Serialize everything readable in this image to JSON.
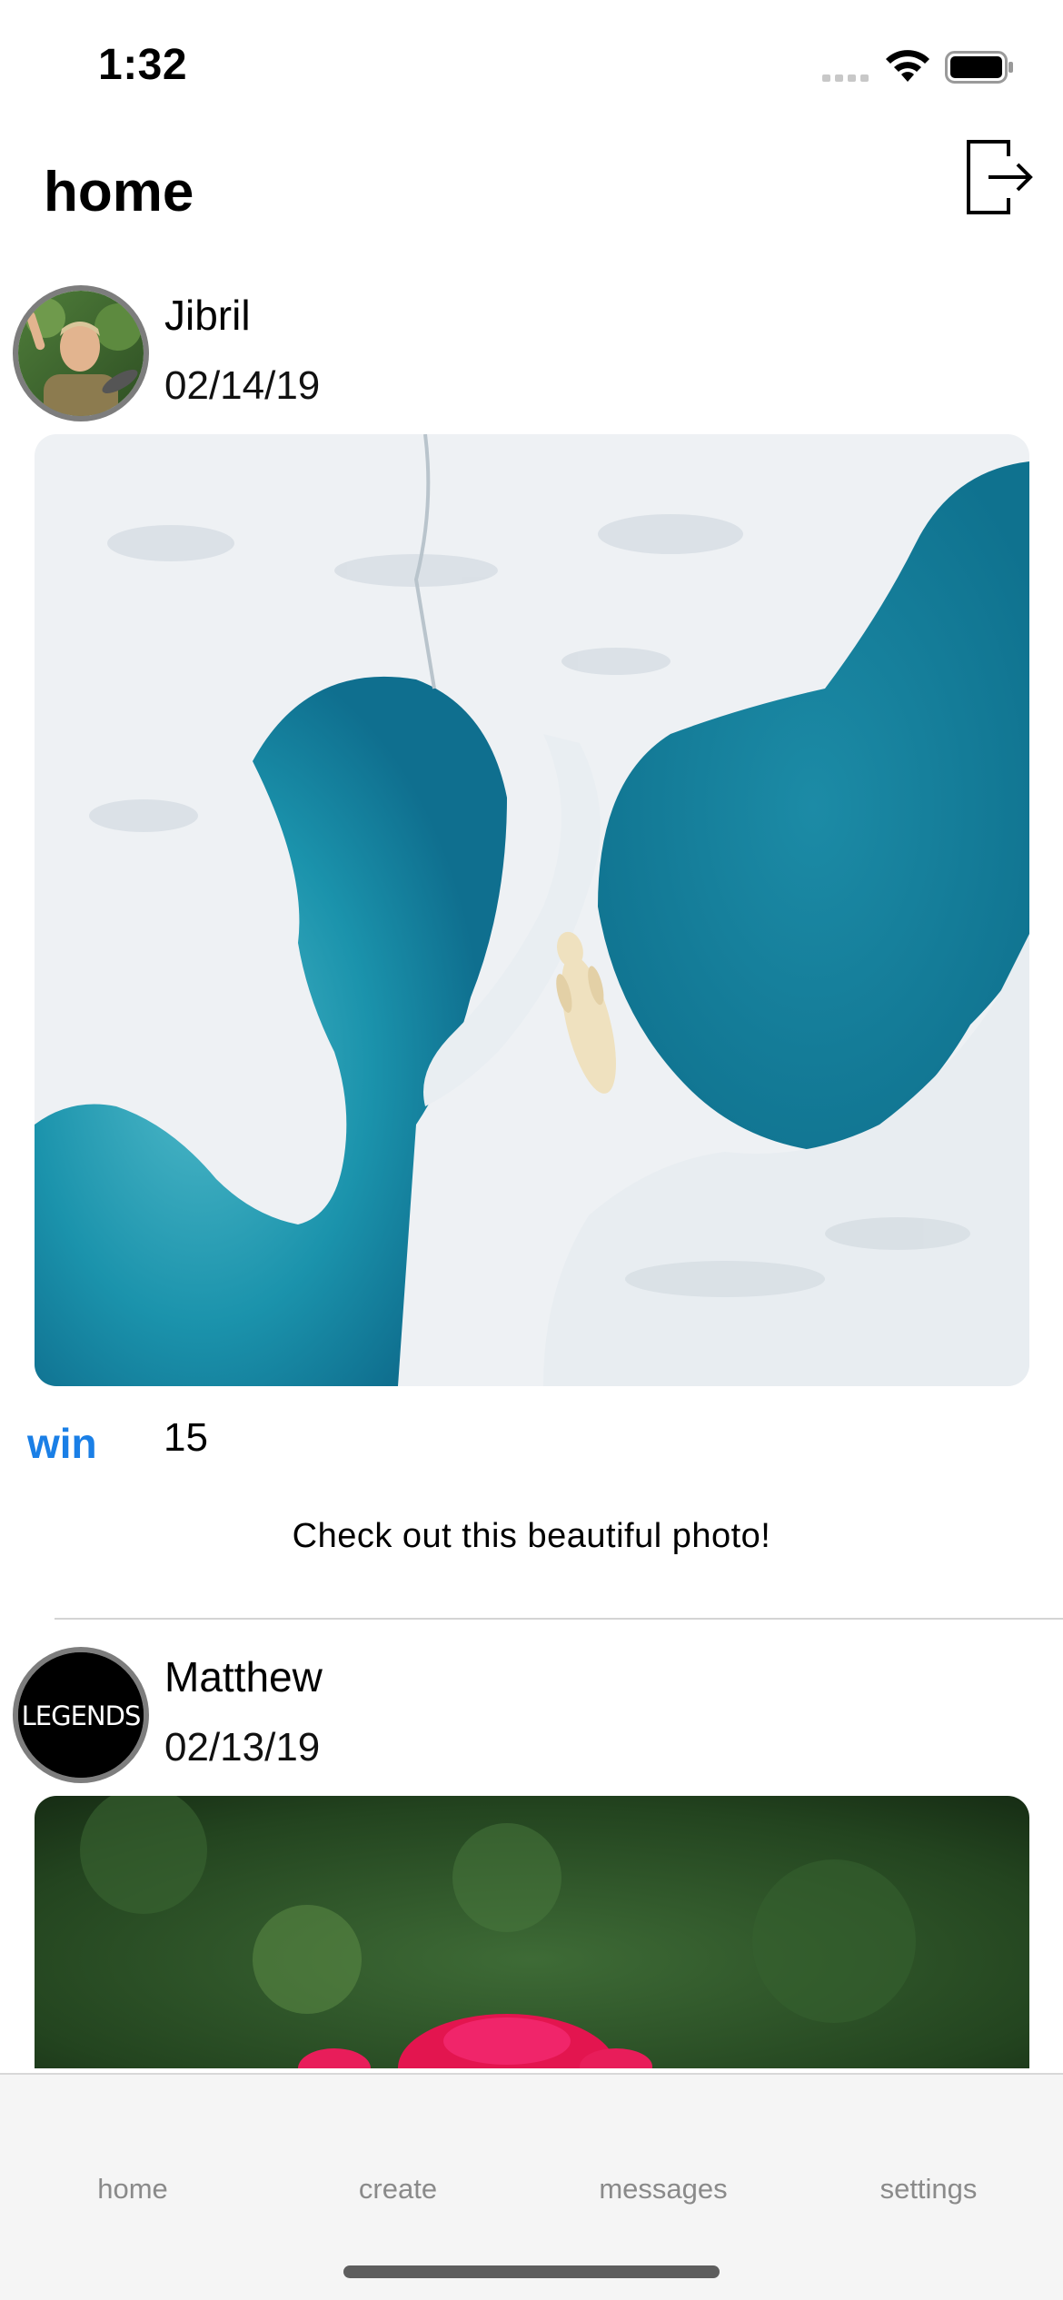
{
  "status_bar": {
    "time": "1:32"
  },
  "header": {
    "title": "home",
    "logout_icon": "logout-icon"
  },
  "posts": [
    {
      "author": "Jibril",
      "date": "02/14/19",
      "image": "polar-bear-on-sea-ice-aerial-photo",
      "win_label": "win",
      "win_count": "15",
      "caption": "Check out this beautiful photo!"
    },
    {
      "author": "Matthew",
      "date": "02/13/19",
      "avatar_text": "LEGENDS",
      "image": "pink-rose-with-green-background-photo"
    }
  ],
  "tabs": [
    {
      "label": "home"
    },
    {
      "label": "create"
    },
    {
      "label": "messages"
    },
    {
      "label": "settings"
    }
  ],
  "colors": {
    "accent": "#1a7fe6",
    "tab_text": "#8a8a8a",
    "tab_bar_bg": "#f5f5f5",
    "avatar_ring": "#7d7d7d"
  }
}
